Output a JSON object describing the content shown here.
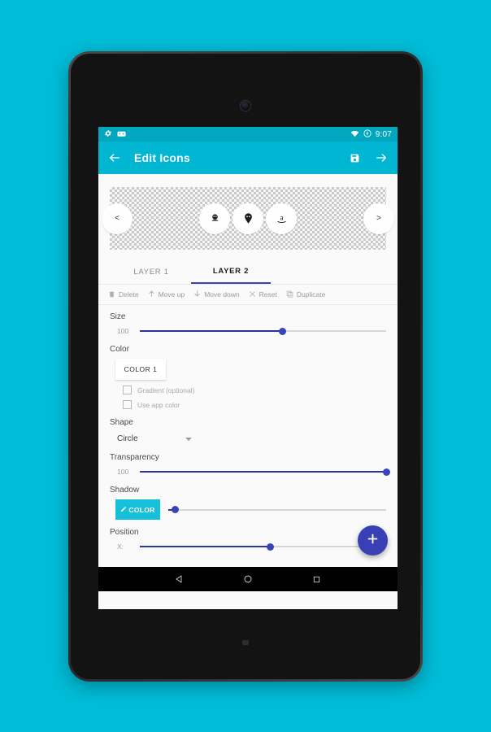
{
  "background_color": "#00bcd7",
  "device": {
    "frame_color": "#2e2e2e",
    "camera": "front-camera-lens"
  },
  "status_bar": {
    "background": "#00a7bf",
    "left_icons": [
      "gear-icon",
      "android-head-icon"
    ],
    "right_icons": [
      "wifi-icon",
      "battery-charging-icon"
    ],
    "time": "9:07"
  },
  "app_bar": {
    "background": "#00b6d2",
    "back_icon": "arrow-left-icon",
    "title": "Edit Icons",
    "actions": [
      "save-icon",
      "arrow-right-icon"
    ]
  },
  "preview": {
    "prev_label": "<",
    "next_label": ">",
    "icons": [
      {
        "name": "icon-slot-1",
        "glyph": "☘"
      },
      {
        "name": "icon-slot-2",
        "glyph": "⚲"
      },
      {
        "name": "icon-slot-3",
        "glyph": "a"
      }
    ]
  },
  "tabs": [
    {
      "label": "LAYER 1",
      "active": false
    },
    {
      "label": "LAYER 2",
      "active": true
    }
  ],
  "toolbar": [
    {
      "icon": "trash-icon",
      "label": "Delete"
    },
    {
      "icon": "arrow-up-icon",
      "label": "Move up"
    },
    {
      "icon": "arrow-down-icon",
      "label": "Move down"
    },
    {
      "icon": "close-x-icon",
      "label": "Reset"
    },
    {
      "icon": "duplicate-icon",
      "label": "Duplicate"
    }
  ],
  "settings": {
    "size": {
      "label": "Size",
      "value": "100",
      "percent": 58
    },
    "color": {
      "label": "Color",
      "button_label": "COLOR 1"
    },
    "gradient_checkbox": {
      "label": "Gradient (optional)",
      "checked": false
    },
    "use_app_color_checkbox": {
      "label": "Use app color",
      "checked": false
    },
    "shape": {
      "label": "Shape",
      "value": "Circle"
    },
    "transparency": {
      "label": "Transparency",
      "value": "100",
      "percent": 100
    },
    "shadow": {
      "label": "Shadow",
      "button_label": "COLOR",
      "button_color": "#16c0d9",
      "percent": 3
    },
    "position": {
      "label": "Position",
      "axis_label": "X:",
      "percent": 53
    }
  },
  "fab": {
    "icon": "plus-icon"
  },
  "nav_bar": {
    "buttons": [
      {
        "name": "back-button",
        "icon": "triangle-back-icon"
      },
      {
        "name": "home-button",
        "icon": "circle-home-icon"
      },
      {
        "name": "recents-button",
        "icon": "square-recents-icon"
      }
    ]
  }
}
